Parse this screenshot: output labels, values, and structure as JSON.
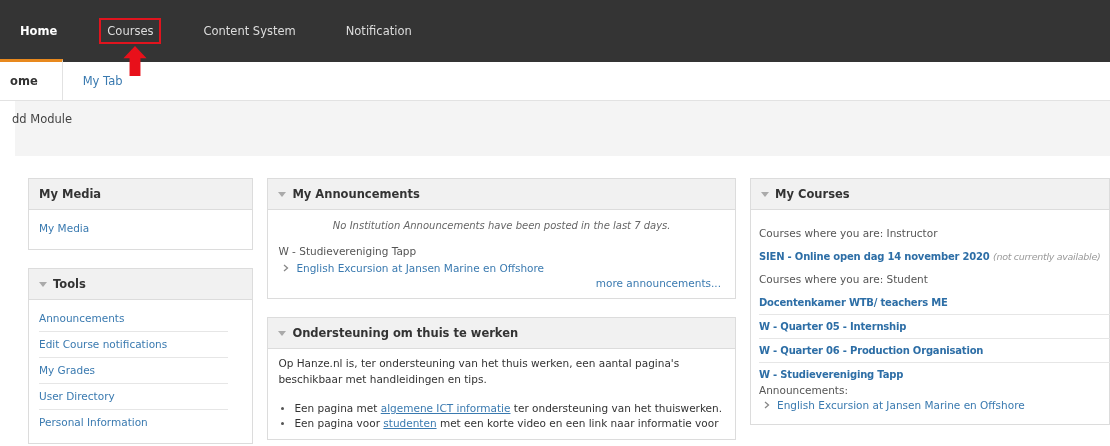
{
  "nav": [
    {
      "label": "Home",
      "selected": true,
      "highlighted": false
    },
    {
      "label": "Courses",
      "selected": false,
      "highlighted": true
    },
    {
      "label": "Content System",
      "selected": false,
      "highlighted": false
    },
    {
      "label": "Notification",
      "selected": false,
      "highlighted": false
    }
  ],
  "tabs": [
    {
      "label": "ome",
      "selected": true
    },
    {
      "label": "My Tab",
      "selected": false
    }
  ],
  "toolbar": {
    "label": "dd Module"
  },
  "columns": [
    {
      "modules": [
        {
          "kind": "links",
          "title": "My Media",
          "collapsible": false,
          "links": [
            "My Media"
          ]
        },
        {
          "kind": "links",
          "title": "Tools",
          "collapsible": true,
          "links": [
            "Announcements",
            "Edit Course notifications",
            "My Grades",
            "User Directory",
            "Personal Information"
          ]
        }
      ]
    },
    {
      "modules": [
        {
          "kind": "announcements",
          "title": "My Announcements",
          "collapsible": true,
          "notice": "No Institution Announcements have been posted in the last 7 days.",
          "group": "W - Studievereniging Tapp",
          "links": [
            "English Excursion at Jansen Marine en Offshore"
          ],
          "more": "more announcements..."
        },
        {
          "kind": "text",
          "title": "Ondersteuning om thuis te werken",
          "collapsible": true,
          "paragraph": "Op Hanze.nl is, ter ondersteuning van het thuis werken, een aantal pagina's beschikbaar met handleidingen en tips.",
          "bullets": [
            {
              "before": "Een pagina met ",
              "link": "algemene ICT informatie",
              "after": " ter ondersteuning van het thuiswerken."
            },
            {
              "before": "Een pagina voor ",
              "link": "studenten",
              "after": " met een korte video en een link naar informatie voor"
            }
          ]
        }
      ]
    },
    {
      "modules": [
        {
          "kind": "courses",
          "title": "My Courses",
          "collapsible": true,
          "items": [
            {
              "kind": "role",
              "text": "Courses where you are: Instructor"
            },
            {
              "kind": "course",
              "text": "SIEN - Online open dag 14 november 2020",
              "note": "(not currently available)"
            },
            {
              "kind": "role",
              "text": "Courses where you are: Student"
            },
            {
              "kind": "course",
              "text": "Docentenkamer WTB/ teachers ME"
            },
            {
              "kind": "course",
              "text": "W - Quarter 05 - Internship"
            },
            {
              "kind": "course",
              "text": "W - Quarter 06 - Production Organisation"
            },
            {
              "kind": "course",
              "text": "W - Studievereniging Tapp",
              "sub_label": "Announcements:",
              "sub_links": [
                "English Excursion at Jansen Marine en Offshore"
              ]
            }
          ]
        }
      ]
    }
  ]
}
